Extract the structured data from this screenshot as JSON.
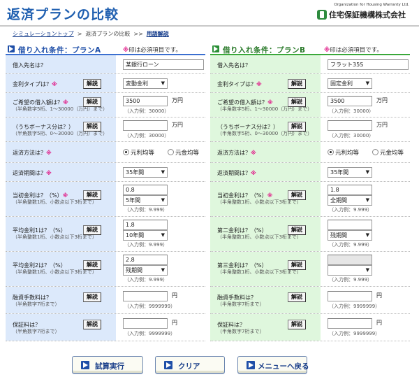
{
  "page": {
    "title": "返済プランの比較"
  },
  "logo": {
    "subtitle": "Organization for Housing Warranty Ltd.",
    "name": "住宅保証機構株式会社"
  },
  "breadcrumb": {
    "home": "シミュレーショントップ",
    "sep": ">",
    "current": "返済プランの比較",
    "sep2": ">>",
    "glossary": "用語解説"
  },
  "common": {
    "explain": "解説",
    "req_mark": "※",
    "unit_man": "万円",
    "unit_yen": "円"
  },
  "plan_a": {
    "title": "借り入れ条件：プランA",
    "note_mark": "※",
    "note_text": "印は必須項目です。",
    "lender": {
      "label": "借入先名は？",
      "value": "某銀行ローン"
    },
    "rate_type": {
      "label": "金利タイプは？",
      "value": "変動金利"
    },
    "amount": {
      "label": "ご希望の借入額は？",
      "hint": "（半角数字5桁、1〜30000（万円）まで）",
      "value": "3500",
      "example": "（入力例：30000）"
    },
    "bonus": {
      "label": "（うちボーナス分は？）",
      "hint": "（半角数字5桁、0〜30000（万円）まで）",
      "value": "",
      "example": "（入力例：30000）"
    },
    "method": {
      "label": "返済方法は？",
      "opt1": "元利均等",
      "opt2": "元金均等",
      "selected": "元利均等"
    },
    "period": {
      "label": "返済期間は？",
      "value": "35年間"
    },
    "rate1": {
      "label": "当初金利は？（%）",
      "hint": "（半角整数1桁、小数点以下3桁まで）",
      "value": "0.8",
      "term": "5年間",
      "example": "（入力例：9.999）"
    },
    "rate2": {
      "label": "平均金利1は？（%）",
      "hint": "（半角整数1桁、小数点以下3桁まで）",
      "value": "1.8",
      "term": "10年間",
      "example": "（入力例：9.999）"
    },
    "rate3": {
      "label": "平均金利2は？（%）",
      "hint": "（半角整数1桁、小数点以下3桁まで）",
      "value": "2.8",
      "term": "残期間",
      "example": "（入力例：9.999）"
    },
    "fee": {
      "label": "融資手数料は？",
      "hint": "（半角数字7桁まで）",
      "value": "",
      "example": "（入力例：9999999）"
    },
    "guarantee": {
      "label": "保証料は？",
      "hint": "（半角数字7桁まで）",
      "value": "",
      "example": "（入力例：9999999）"
    }
  },
  "plan_b": {
    "title": "借り入れ条件：プランB",
    "note_mark": "※",
    "note_text": "印は必須項目です。",
    "lender": {
      "label": "借入先名は？",
      "value": "フラット35S"
    },
    "rate_type": {
      "label": "金利タイプは？",
      "value": "固定金利"
    },
    "amount": {
      "label": "ご希望の借入額は？",
      "hint": "（半角数字5桁、1〜30000（万円）まで）",
      "value": "3500",
      "example": "（入力例：30000）"
    },
    "bonus": {
      "label": "（うちボーナス分は？）",
      "hint": "（半角数字5桁、0〜30000（万円）まで）",
      "value": "",
      "example": "（入力例：30000）"
    },
    "method": {
      "label": "返済方法は？",
      "opt1": "元利均等",
      "opt2": "元金均等",
      "selected": "元利均等"
    },
    "period": {
      "label": "返済期間は？",
      "value": "35年間"
    },
    "rate1": {
      "label": "当初金利は？（%）",
      "hint": "（半角整数1桁、小数点以下3桁まで）",
      "value": "1.8",
      "term": "全期間",
      "example": "（入力例：9.999）"
    },
    "rate2": {
      "label": "第二金利は？（%）",
      "hint": "（半角整数1桁、小数点以下3桁まで）",
      "value": "",
      "term": "残期間",
      "example": "（入力例：9.999）"
    },
    "rate3": {
      "label": "第三金利は？（%）",
      "hint": "（半角整数1桁、小数点以下3桁まで）",
      "value": "",
      "term": "",
      "example": "（入力例：9.999）"
    },
    "fee": {
      "label": "融資手数料は？",
      "hint": "（半角数字7桁まで）",
      "value": "",
      "example": "（入力例：9999999）"
    },
    "guarantee": {
      "label": "保証料は？",
      "hint": "（半角数字7桁まで）",
      "value": "",
      "example": "（入力例：9999999）"
    }
  },
  "buttons": {
    "calc": "試算実行",
    "clear": "クリア",
    "menu": "メニューへ戻る"
  }
}
